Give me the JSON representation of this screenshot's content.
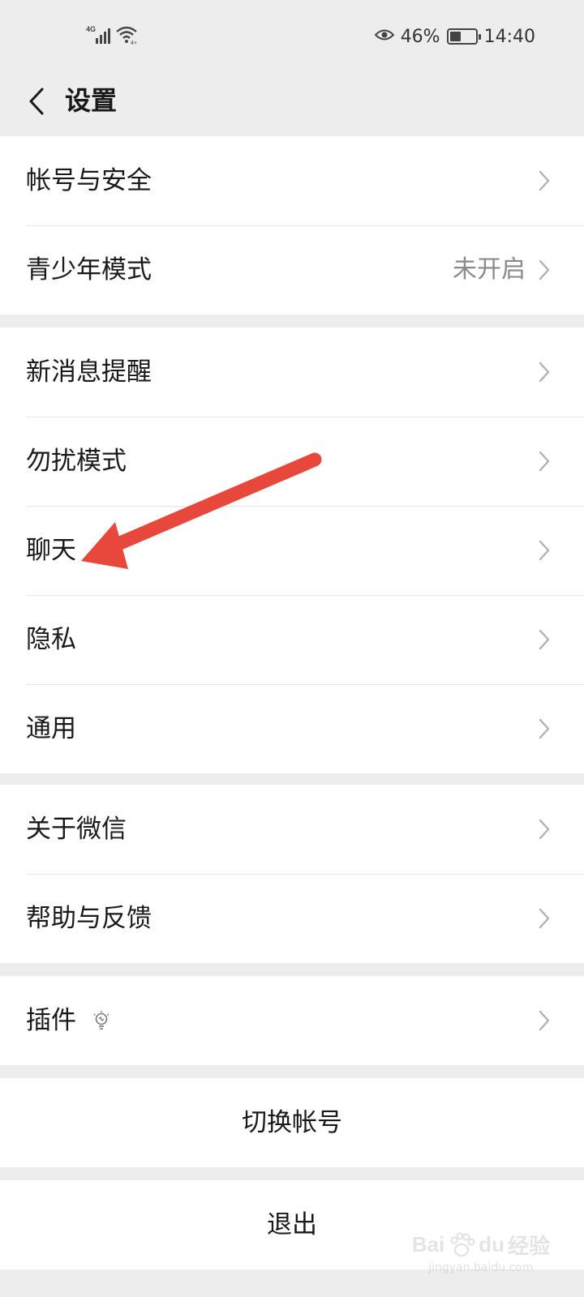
{
  "status_bar": {
    "network_label": "4G",
    "battery_percent": "46%",
    "battery_level": 0.46,
    "time": "14:40"
  },
  "nav": {
    "title": "设置"
  },
  "groups": [
    {
      "items": [
        {
          "label": "帐号与安全",
          "value": ""
        },
        {
          "label": "青少年模式",
          "value": "未开启"
        }
      ]
    },
    {
      "items": [
        {
          "label": "新消息提醒",
          "value": ""
        },
        {
          "label": "勿扰模式",
          "value": ""
        },
        {
          "label": "聊天",
          "value": ""
        },
        {
          "label": "隐私",
          "value": ""
        },
        {
          "label": "通用",
          "value": ""
        }
      ]
    },
    {
      "items": [
        {
          "label": "关于微信",
          "value": ""
        },
        {
          "label": "帮助与反馈",
          "value": ""
        }
      ]
    },
    {
      "items": [
        {
          "label": "插件",
          "value": ""
        }
      ]
    }
  ],
  "actions": {
    "switch_account": "切换帐号",
    "logout": "退出"
  },
  "watermark": {
    "logo": "Bai",
    "logo_suffix": "du",
    "cn": "经验",
    "url": "jingyan.baidu.com"
  },
  "colors": {
    "background": "#ededed",
    "arrow": "#e8473b",
    "secondary_text": "#8a8a8a"
  }
}
